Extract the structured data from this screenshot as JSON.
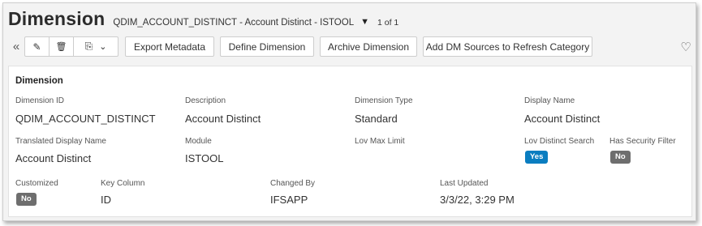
{
  "header": {
    "title": "Dimension",
    "subtitle": "QDIM_ACCOUNT_DISTINCT - Account Distinct - ISTOOL",
    "caret": "▼",
    "counter": "1 of 1"
  },
  "toolbar": {
    "collapse_icon": "«",
    "edit_icon": "✎",
    "delete_icon": "🗑",
    "copy_icon": "⎘",
    "chevron_icon": "⌄",
    "favorite_icon": "♡",
    "buttons": {
      "export": "Export Metadata",
      "define": "Define Dimension",
      "archive": "Archive Dimension",
      "add_sources": "Add DM Sources to Refresh Category"
    }
  },
  "card": {
    "title": "Dimension",
    "fields": {
      "dimension_id": {
        "label": "Dimension ID",
        "value": "QDIM_ACCOUNT_DISTINCT"
      },
      "description": {
        "label": "Description",
        "value": "Account Distinct"
      },
      "dimension_type": {
        "label": "Dimension Type",
        "value": "Standard"
      },
      "display_name": {
        "label": "Display Name",
        "value": "Account Distinct"
      },
      "translated_display_name": {
        "label": "Translated Display Name",
        "value": "Account Distinct"
      },
      "module": {
        "label": "Module",
        "value": "ISTOOL"
      },
      "lov_max_limit": {
        "label": "Lov Max Limit",
        "value": ""
      },
      "lov_distinct_search": {
        "label": "Lov Distinct Search",
        "value": "Yes"
      },
      "has_security_filter": {
        "label": "Has Security Filter",
        "value": "No"
      },
      "customized": {
        "label": "Customized",
        "value": "No"
      },
      "key_column": {
        "label": "Key Column",
        "value": "ID"
      },
      "changed_by": {
        "label": "Changed By",
        "value": "IFSAPP"
      },
      "last_updated": {
        "label": "Last Updated",
        "value": "3/3/22, 3:29 PM"
      }
    }
  },
  "colors": {
    "yes_badge": "#0a7dc0",
    "no_badge": "#6e6e6e"
  }
}
